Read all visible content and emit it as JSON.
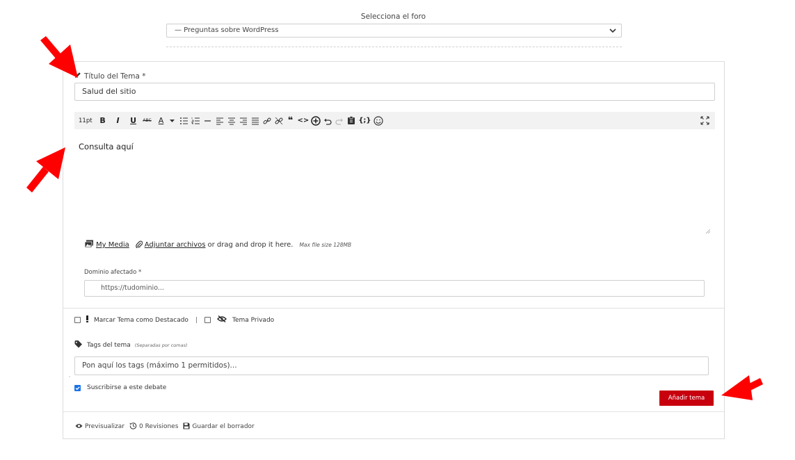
{
  "forum": {
    "label": "Selecciona el foro",
    "selected": "— Preguntas sobre WordPress"
  },
  "topic": {
    "title_label": "Título del Tema *",
    "title_value": "Salud del sitio"
  },
  "editor": {
    "font_size": "11pt",
    "bold": "B",
    "italic": "I",
    "underline": "U",
    "strikethrough": "ABC",
    "text_color": "A",
    "quote": "❝",
    "code": "<>",
    "shortcode": "{;}",
    "content": "Consulta aquí"
  },
  "media": {
    "my_media": "My Media",
    "attach": "Adjuntar archivos",
    "drop_text": "or drag and drop it here.",
    "max_size": "Max file size 128MB"
  },
  "domain": {
    "label": "Dominio afectado *",
    "placeholder": "https://tudominio..."
  },
  "options": {
    "featured": "Marcar Tema como Destacado",
    "separator": "|",
    "private": "Tema Privado"
  },
  "tags": {
    "label": "Tags del tema",
    "hint": "(Separadas por comas)",
    "placeholder": "Pon aquí los tags (máximo 1 permitidos)..."
  },
  "subscribe": {
    "label": "Suscribirse a este debate",
    "checked": true
  },
  "submit": {
    "label": "Añadir tema"
  },
  "footer": {
    "preview": "Previsualizar",
    "revisions": "0 Revisiones",
    "save_draft": "Guardar el borrador"
  },
  "colors": {
    "accent": "#c8000e",
    "annotation_arrow": "#ff0000",
    "checkbox_checked": "#1a73e8"
  }
}
